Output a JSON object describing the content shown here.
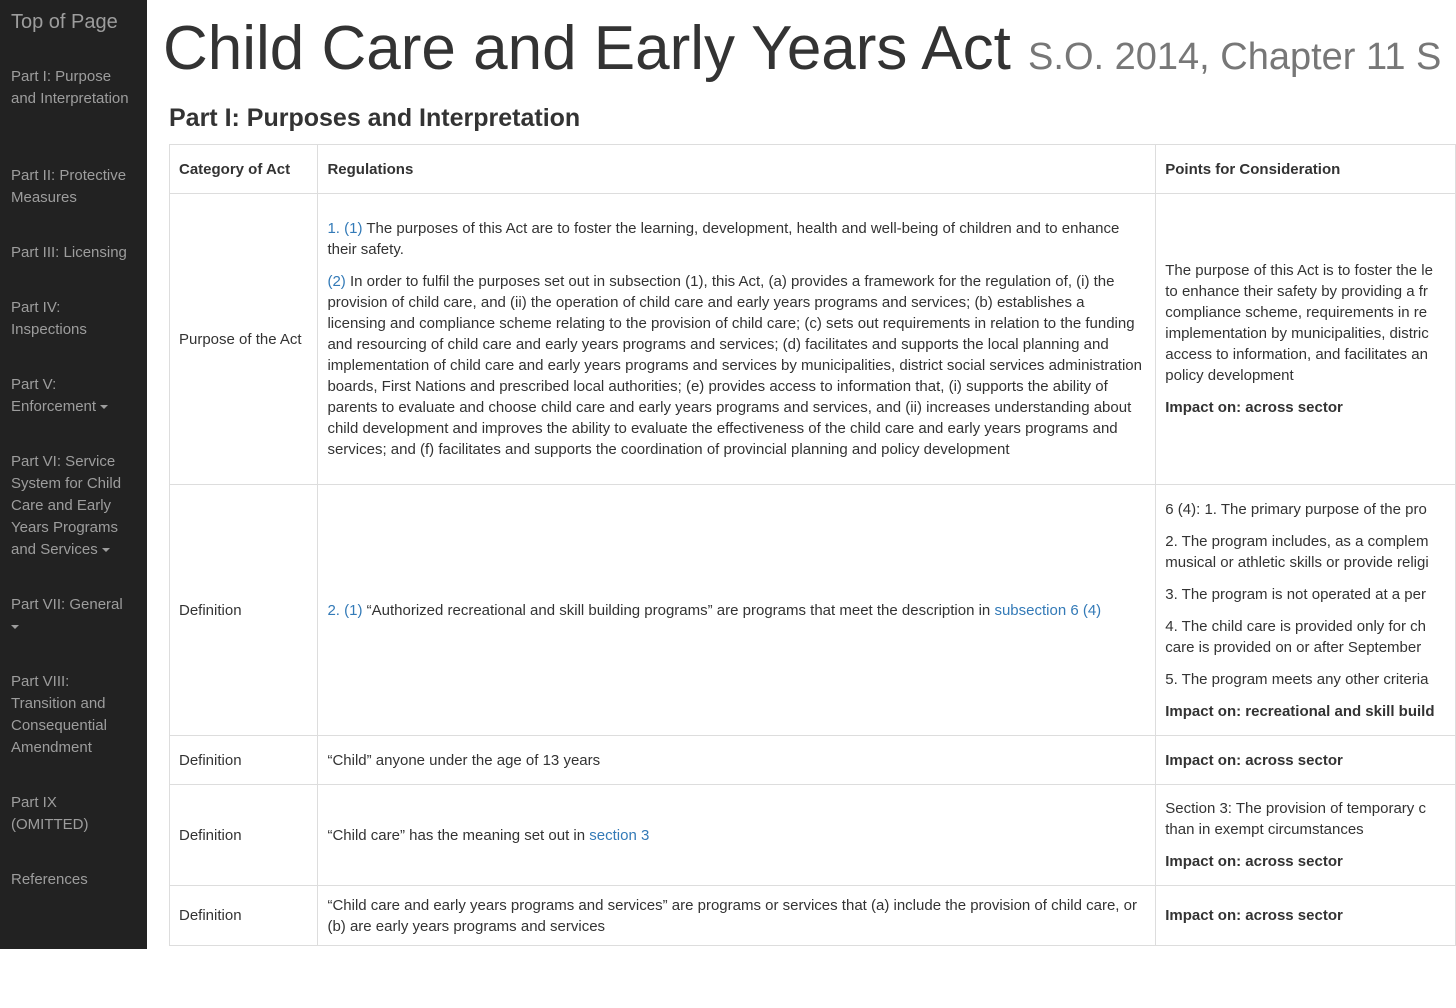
{
  "sidebar": {
    "top_label": "Top of Page",
    "items": [
      {
        "label": "Part I: Purpose and Interpretation"
      },
      {
        "label": "Part II: Protective Measures"
      },
      {
        "label": "Part III: Licensing"
      },
      {
        "label": "Part IV: Inspections"
      },
      {
        "label": "Part V: Enforcement"
      },
      {
        "label": "Part VI: Service System for Child Care and Early Years Programs and Services"
      },
      {
        "label": "Part VII: General"
      },
      {
        "label": "Part VIII: Transition and Consequential Amendment"
      },
      {
        "label": "Part IX (OMITTED)"
      },
      {
        "label": "References"
      }
    ]
  },
  "header": {
    "title": "Child Care and Early Years Act",
    "subtitle": "S.O. 2014, Chapter 11 S"
  },
  "section": {
    "title": "Part I: Purposes and Interpretation"
  },
  "table": {
    "headers": [
      "Category of Act",
      "Regulations",
      "Points for Consideration"
    ],
    "rows": [
      {
        "category": "Purpose of the Act",
        "reg_link_1": "1. (1)",
        "reg_text_1": " The purposes of this Act are to foster the learning, development, health and well-being of children and to enhance their safety.",
        "reg_link_2": "(2)",
        "reg_text_2": " In order to fulfil the purposes set out in subsection (1), this Act, (a) provides a framework for the regulation of, (i) the provision of child care, and (ii) the operation of child care and early years programs and services; (b) establishes a licensing and compliance scheme relating to the provision of child care; (c) sets out requirements in relation to the funding and resourcing of child care and early years programs and services; (d) facilitates and supports the local planning and implementation of child care and early years programs and services by municipalities, district social services administration boards, First Nations and prescribed local authorities; (e) provides access to information that, (i) supports the ability of parents to evaluate and choose child care and early years programs and services, and (ii) increases understanding about child development and improves the ability to evaluate the effectiveness of the child care and early years programs and services; and (f) facilitates and supports the coordination of provincial planning and policy development",
        "points_lines": [
          "The purpose of this Act is to foster the le",
          "to enhance their safety by providing a fr",
          "compliance scheme, requirements in re",
          "implementation by municipalities, distric",
          "access to information, and facilitates an",
          "policy development"
        ],
        "impact": "Impact on: across sector"
      },
      {
        "category": "Definition",
        "reg_link_1": "2. (1)",
        "reg_text_1": " “Authorized recreational and skill building programs” are programs that meet the description in ",
        "reg_link_2": "subsection 6 (4)",
        "points": [
          {
            "lines": [
              "6 (4): 1. The primary purpose of the pro"
            ]
          },
          {
            "lines": [
              "2. The program includes, as a complem",
              "musical or athletic skills or provide religi"
            ]
          },
          {
            "lines": [
              "3. The program is not operated at a per"
            ]
          },
          {
            "lines": [
              "4. The child care is provided only for ch",
              "care is provided on or after September"
            ]
          },
          {
            "lines": [
              "5. The program meets any other criteria"
            ]
          }
        ],
        "impact": "Impact on: recreational and skill build"
      },
      {
        "category": "Definition",
        "reg_text_1": "“Child” anyone under the age of 13 years",
        "impact": "Impact on: across sector"
      },
      {
        "category": "Definition",
        "reg_text_1": "“Child care” has the meaning set out in ",
        "reg_link_1": "section 3",
        "points_lines": [
          "Section 3: The provision of temporary c",
          "than in exempt circumstances"
        ],
        "impact": "Impact on: across sector"
      },
      {
        "category": "Definition",
        "reg_text_1": "“Child care and early years programs and services” are programs or services that (a) include the provision of child care, or (b) are early years programs and services",
        "impact": "Impact on: across sector"
      }
    ]
  }
}
